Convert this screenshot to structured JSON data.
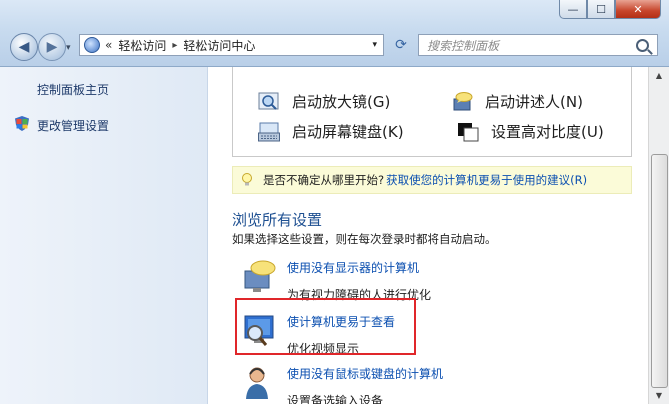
{
  "window": {
    "minimize": "—",
    "maximize": "☐",
    "close": "✕"
  },
  "nav": {
    "back": "◀",
    "forward": "▶",
    "dropdown": "▾"
  },
  "address": {
    "prefix": "«",
    "crumbs": [
      "轻松访问",
      "轻松访问中心"
    ],
    "sep": "▸",
    "dropdown": "▾"
  },
  "refresh": "⟳",
  "search": {
    "placeholder": "搜索控制面板"
  },
  "sidebar": {
    "items": [
      {
        "label": "控制面板主页"
      },
      {
        "label": "更改管理设置"
      }
    ]
  },
  "tools": [
    {
      "label": "启动放大镜(G)",
      "icon": "magnifier-icon"
    },
    {
      "label": "启动讲述人(N)",
      "icon": "narrator-icon"
    },
    {
      "label": "启动屏幕键盘(K)",
      "icon": "keyboard-icon"
    },
    {
      "label": "设置高对比度(U)",
      "icon": "contrast-icon"
    }
  ],
  "tip": {
    "text": "是否不确定从哪里开始?",
    "link": "获取使您的计算机更易于使用的建议(R)"
  },
  "browse": {
    "heading": "浏览所有设置",
    "subtext": "如果选择这些设置，则在每次登录时都将自动启动。",
    "items": [
      {
        "title": "使用没有显示器的计算机",
        "desc": "为有视力障碍的人进行优化"
      },
      {
        "title": "使计算机更易于查看",
        "desc": "优化视频显示"
      },
      {
        "title": "使用没有鼠标或键盘的计算机",
        "desc": "设置备选输入设备"
      }
    ]
  },
  "colors": {
    "link": "#0b4fb0",
    "heading": "#1d4f91",
    "highlight": "#e0262a"
  }
}
